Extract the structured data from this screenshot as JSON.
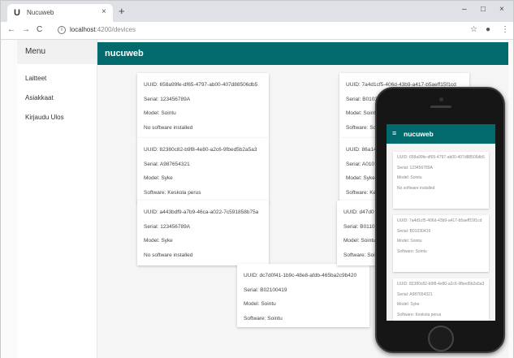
{
  "browser": {
    "tab_title": "Nucuweb",
    "tab_logo": "U",
    "close_glyph": "×",
    "new_tab_glyph": "+",
    "minimize_glyph": "–",
    "maximize_glyph": "□",
    "window_close_glyph": "×",
    "back_glyph": "←",
    "forward_glyph": "→",
    "reload_glyph": "C",
    "info_glyph": "i",
    "url_host": "localhost",
    "url_rest": ":4200/devices",
    "star_glyph": "☆",
    "account_glyph": "●",
    "menu_glyph": "⋮"
  },
  "sidenav": {
    "header": "Menu",
    "items": [
      "Laitteet",
      "Asiakkaat",
      "Kirjaudu Ulos"
    ]
  },
  "toolbar": {
    "title": "nucuweb"
  },
  "devices": [
    {
      "uuid": "UUID: 658a99fe-df65-4797-ab00-407d88506db5",
      "serial": "Serial: 123456789A",
      "model": "Model: Sointu",
      "software": "No software installed"
    },
    {
      "uuid": "UUID: 82380c82-b9f8-4e80-a2c6-9fbed5b2a5a3",
      "serial": "Serial: A987654321",
      "model": "Model: Syke",
      "software": "Software: Keskola perus"
    },
    {
      "uuid": "UUID: a443bdf9-a7b9-46ca-a022-7c591858b75a",
      "serial": "Serial: 123456789A",
      "model": "Model: Syke",
      "software": "No software installed"
    },
    {
      "uuid": "UUID: dc7d0f41-1b9c-48e8-afdb-465ba2c9b420",
      "serial": "Serial: B02100419",
      "model": "Model: Sointu",
      "software": "Software: Sointu"
    },
    {
      "uuid": "UUID: 7a4d1cf5-406d-43b9-a417-b5aeff15f1cd",
      "serial": "Serial: B01030",
      "model": "Model: Sointu",
      "software": "Software: So"
    },
    {
      "uuid": "UUID: 86a14",
      "serial": "Serial: A010",
      "model": "Model: Syke",
      "software": "Software: Ke"
    },
    {
      "uuid": "UUID: d47d0",
      "serial": "Serial: B0110",
      "model": "Model: Sointu",
      "software": "Software: Soi"
    }
  ],
  "mobile": {
    "menu_glyph": "≡",
    "title": "nucuweb",
    "cards": [
      {
        "uuid": "UUID: 658a99fe-df65-4797-ab00-407d88506db5",
        "serial": "Serial: 123456789A",
        "model": "Model: Sointu",
        "software": "No software installed"
      },
      {
        "uuid": "UUID: 7a4d1cf5-406d-43b9-a417-b5aeff15f1cd",
        "serial": "Serial: B01030419",
        "model": "Model: Sointu",
        "software": "Software: Sointu"
      },
      {
        "uuid": "UUID: 82380c82-b9f8-4e80-a2c6-9fbed5b2a5a3",
        "serial": "Serial: A987654321",
        "model": "Model: Syke",
        "software": "Software: Keskola perus"
      }
    ]
  },
  "colors": {
    "toolbar": "#006a6d",
    "page_bg": "#f5f5f5"
  }
}
